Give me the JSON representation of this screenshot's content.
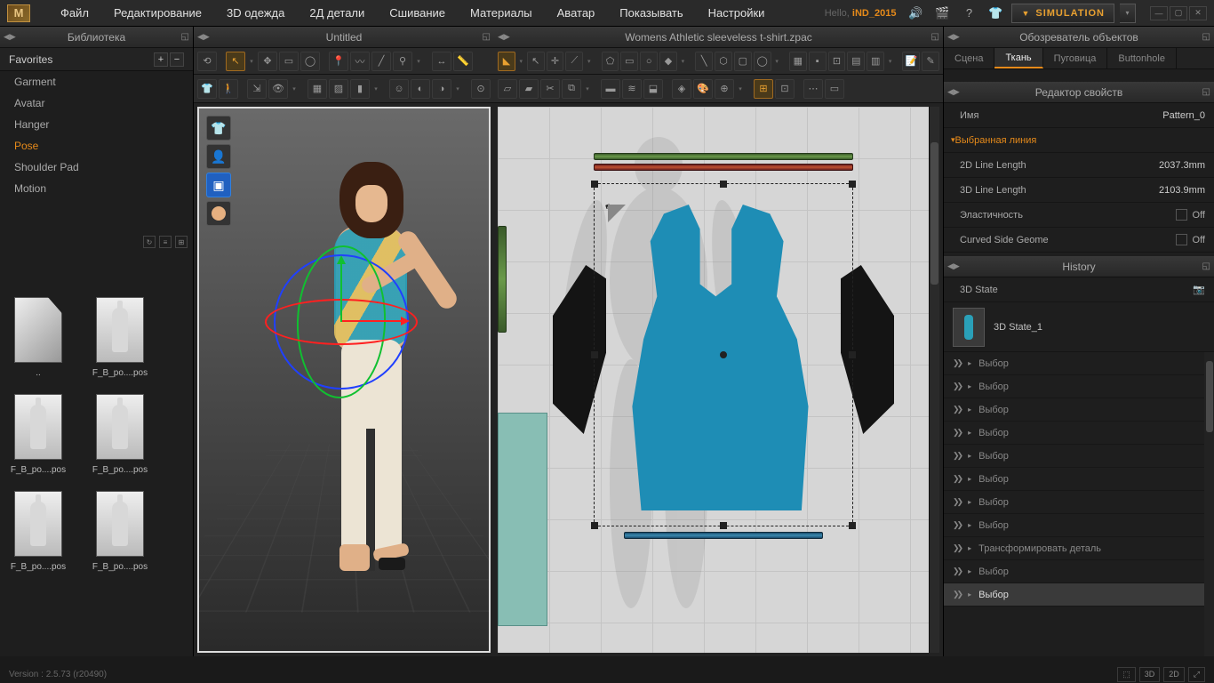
{
  "menubar": {
    "logo": "M",
    "items": [
      "Файл",
      "Редактирование",
      "3D одежда",
      "2Д детали",
      "Сшивание",
      "Материалы",
      "Аватар",
      "Показывать",
      "Настройки"
    ],
    "hello_prefix": "Hello, ",
    "username": "iND_2015",
    "simulation": "SIMULATION"
  },
  "library": {
    "title": "Библиотека",
    "favorites": "Favorites",
    "items": [
      "Garment",
      "Avatar",
      "Hanger",
      "Pose",
      "Shoulder Pad",
      "Motion"
    ],
    "selected_index": 3,
    "thumbs": [
      {
        "label": "..",
        "folder": true
      },
      {
        "label": "F_B_po....pos"
      },
      {
        "label": "F_B_po....pos"
      },
      {
        "label": "F_B_po....pos"
      },
      {
        "label": "F_B_po....pos"
      },
      {
        "label": "F_B_po....pos"
      }
    ]
  },
  "viewport3d": {
    "title": "Untitled"
  },
  "viewport2d": {
    "title": "Womens Athletic sleeveless t-shirt.zpac"
  },
  "objects": {
    "title": "Обозреватель объектов",
    "tabs": [
      "Сцена",
      "Ткань",
      "Пуговица",
      "Buttonhole"
    ],
    "active_tab": 1
  },
  "props": {
    "title": "Редактор свойств",
    "name_label": "Имя",
    "name_value": "Pattern_0",
    "section": "Выбранная линия",
    "rows": [
      {
        "label": "2D Line Length",
        "value": "2037.3mm"
      },
      {
        "label": "3D Line Length",
        "value": "2103.9mm"
      },
      {
        "label": "Эластичность",
        "value": "Off",
        "check": true
      },
      {
        "label": "Curved Side Geome",
        "value": "Off",
        "check": true
      }
    ]
  },
  "history": {
    "title": "History",
    "state_label": "3D State",
    "state_name": "3D State_1",
    "items": [
      "Выбор",
      "Выбор",
      "Выбор",
      "Выбор",
      "Выбор",
      "Выбор",
      "Выбор",
      "Выбор",
      "Трансформировать деталь",
      "Выбор",
      "Выбор"
    ]
  },
  "status": {
    "version": "Version : 2.5.73    (r20490)",
    "modes": [
      "⬚",
      "3D",
      "2D",
      "⤢"
    ]
  }
}
